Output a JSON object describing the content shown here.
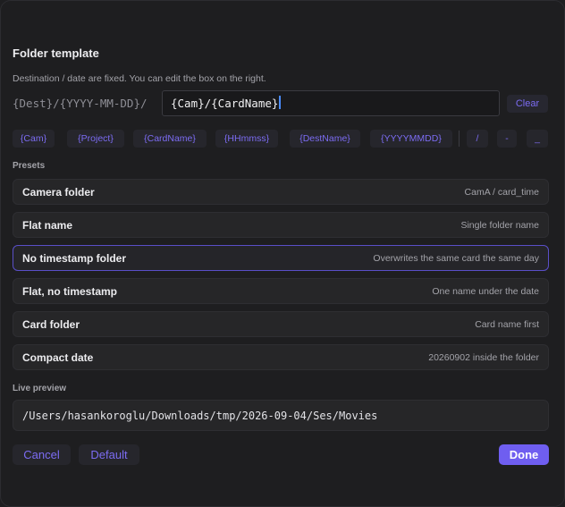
{
  "dialog": {
    "title": "Folder template",
    "subtitle": "Destination / date are fixed. You can edit the box on the right.",
    "fixed_prefix": "{Dest}/{YYYY-MM-DD}/",
    "template_value": "{Cam}/{CardName}",
    "clear_label": "Clear"
  },
  "tokens": [
    "{Cam}",
    "{Project}",
    "{CardName}",
    "{HHmmss}",
    "{DestName}",
    "{YYYYMMDD}"
  ],
  "separators": [
    "/",
    "-",
    "_"
  ],
  "presets_label": "Presets",
  "presets": [
    {
      "name": "Camera folder",
      "description": "CamA / card_time",
      "selected": false
    },
    {
      "name": "Flat name",
      "description": "Single folder name",
      "selected": false
    },
    {
      "name": "No timestamp folder",
      "description": "Overwrites the same card the same day",
      "selected": true
    },
    {
      "name": "Flat, no timestamp",
      "description": "One name under the date",
      "selected": false
    },
    {
      "name": "Card folder",
      "description": "Card name first",
      "selected": false
    },
    {
      "name": "Compact date",
      "description": "20260902 inside the folder",
      "selected": false
    }
  ],
  "live_preview": {
    "label": "Live preview",
    "path": "/Users/hasankoroglu/Downloads/tmp/2026-09-04/Ses/Movies"
  },
  "buttons": {
    "cancel": "Cancel",
    "default": "Default",
    "done": "Done"
  },
  "colors": {
    "accent": "#6f5ef0",
    "accent_text": "#7c6cf3",
    "background": "#1e1e20",
    "selected_border": "#5a4fc8"
  }
}
